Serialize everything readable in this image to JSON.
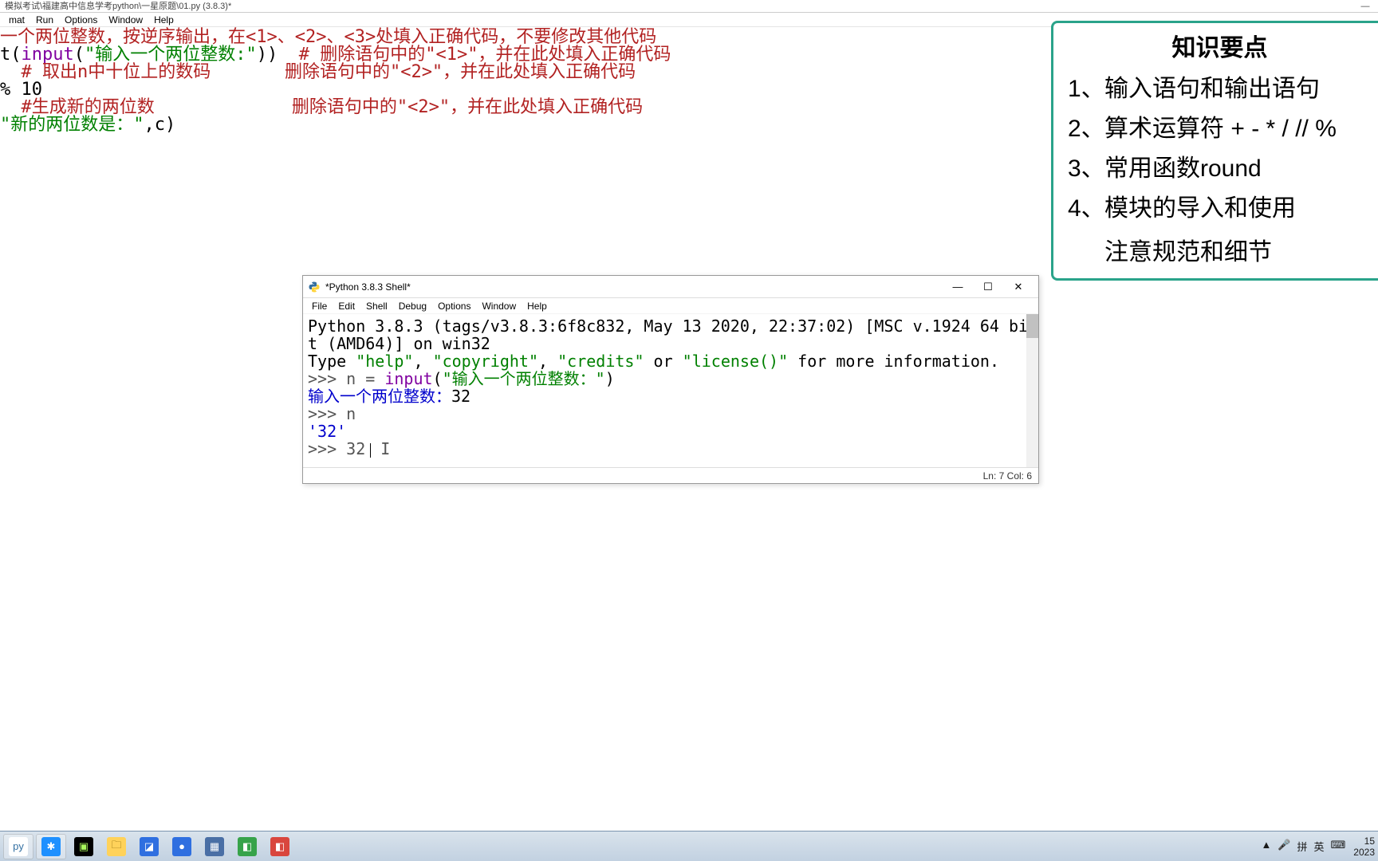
{
  "editor": {
    "title": "模拟考试\\福建高中信息学考python\\一星原题\\01.py (3.8.3)*",
    "menu": [
      "mat",
      "Run",
      "Options",
      "Window",
      "Help"
    ],
    "lines": [
      [
        {
          "t": "一个两位整数，按逆序输出，在<1>、<2>、<3>处填入正确代码，不要修改其他代码",
          "c": "c-red"
        }
      ],
      [
        {
          "t": "t(",
          "c": ""
        },
        {
          "t": "input",
          "c": "c-purple"
        },
        {
          "t": "(",
          "c": ""
        },
        {
          "t": "\"输入一个两位整数:\"",
          "c": "c-green"
        },
        {
          "t": "))  ",
          "c": ""
        },
        {
          "t": "# 删除语句中的\"<1>\"，并在此处填入正确代码",
          "c": "c-red"
        }
      ],
      [
        {
          "t": "  ",
          "c": ""
        },
        {
          "t": "# 取出n中十位上的数码       删除语句中的\"<2>\"，并在此处填入正确代码",
          "c": "c-red"
        }
      ],
      [
        {
          "t": "% 10",
          "c": ""
        }
      ],
      [
        {
          "t": "  ",
          "c": ""
        },
        {
          "t": "#生成新的两位数             删除语句中的\"<2>\"，并在此处填入正确代码",
          "c": "c-red"
        }
      ],
      [
        {
          "t": "\"新的两位数是：\"",
          "c": "c-green"
        },
        {
          "t": ",c)",
          "c": ""
        }
      ]
    ]
  },
  "panel": {
    "title": "知识要点",
    "items": [
      "输入语句和输出语句",
      "算术运算符 + - * / // %",
      "常用函数round",
      "模块的导入和使用"
    ],
    "note": "注意规范和细节"
  },
  "shell": {
    "title": "*Python 3.8.3 Shell*",
    "menu": [
      "File",
      "Edit",
      "Shell",
      "Debug",
      "Options",
      "Window",
      "Help"
    ],
    "banner1": "Python 3.8.3 (tags/v3.8.3:6f8c832, May 13 2020, 22:37:02) [MSC v.1924 64 bit (AMD64)] on win32",
    "banner2a": "Type ",
    "banner2_help": "\"help\"",
    "banner2b": ", ",
    "banner2_copy": "\"copyright\"",
    "banner2c": ", ",
    "banner2_credits": "\"credits\"",
    "banner2d": " or ",
    "banner2_lic": "\"license()\"",
    "banner2e": " for more information.",
    "p1a": ">>> n = ",
    "p1_input": "input",
    "p1b": "(",
    "p1_str": "\"输入一个两位整数：\"",
    "p1c": ")",
    "prompt_line_label": "输入一个两位整数：",
    "prompt_line_value": "32",
    "p2": ">>> n",
    "p2_out": "'32'",
    "p3": ">>> 32",
    "status": "Ln: 7  Col: 6"
  },
  "taskbar": {
    "icons": [
      {
        "name": "python-icon",
        "glyph": "py",
        "bg": "#fff",
        "fg": "#3571a3"
      },
      {
        "name": "star-icon",
        "glyph": "✱",
        "bg": "#1e90ff",
        "fg": "#fff"
      },
      {
        "name": "pycharm-icon",
        "glyph": "▣",
        "bg": "#000",
        "fg": "#a8f75c"
      },
      {
        "name": "explorer-icon",
        "glyph": "🗀",
        "bg": "#ffd25a",
        "fg": "#7a5b00"
      },
      {
        "name": "tool-a-icon",
        "glyph": "◪",
        "bg": "#2f6fe0",
        "fg": "#fff"
      },
      {
        "name": "tool-b-icon",
        "glyph": "●",
        "bg": "#2f6fe0",
        "fg": "#fff"
      },
      {
        "name": "tool-c-icon",
        "glyph": "▦",
        "bg": "#4a6fa5",
        "fg": "#fff"
      },
      {
        "name": "tool-d-icon",
        "glyph": "◧",
        "bg": "#37a34a",
        "fg": "#fff"
      },
      {
        "name": "tool-e-icon",
        "glyph": "◧",
        "bg": "#d9463d",
        "fg": "#fff"
      }
    ],
    "tray": {
      "chevron": "▲",
      "mic": "🎤",
      "ime1": "拼",
      "ime2": "英",
      "kb": "⌨",
      "time": "15",
      "date": "2023"
    }
  }
}
